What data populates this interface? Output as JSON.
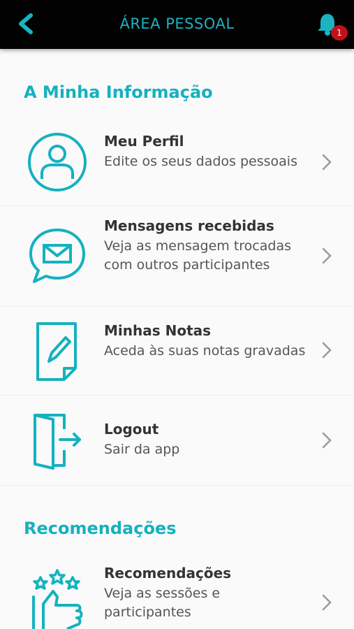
{
  "header": {
    "title": "ÁREA PESSOAL",
    "notification_count": "1"
  },
  "sections": [
    {
      "title": "A Minha Informação",
      "items": [
        {
          "title": "Meu Perfil",
          "desc": "Edite os seus dados pessoais",
          "icon": "profile-icon"
        },
        {
          "title": "Mensagens recebidas",
          "desc": "Veja as mensagem trocadas com outros participantes",
          "icon": "message-bubble-icon"
        },
        {
          "title": "Minhas Notas",
          "desc": "Aceda às suas notas gravadas",
          "icon": "notes-pencil-icon"
        },
        {
          "title": "Logout",
          "desc": "Sair da app",
          "icon": "logout-door-icon"
        }
      ]
    },
    {
      "title": "Recomendações",
      "items": [
        {
          "title": "Recomendações",
          "desc": "Veja as sessões e participantes",
          "icon": "thumbs-up-stars-icon"
        }
      ]
    }
  ],
  "colors": {
    "accent": "#15b1bf",
    "header_bg": "#020202",
    "badge": "#c0121b"
  }
}
